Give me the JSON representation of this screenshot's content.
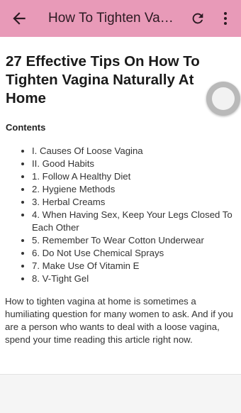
{
  "toolbar": {
    "title": "How To Tighten Vagina Naturally At Home",
    "back_icon": "back-arrow-icon",
    "refresh_icon": "refresh-icon",
    "more_icon": "more-vert-icon",
    "background": "#e89ab8"
  },
  "article": {
    "title": "27 Effective Tips On How To Tighten Vagina Naturally At Home",
    "contents_label": "Contents",
    "toc": [
      "I. Causes Of Loose Vagina",
      "II. Good Habits",
      "1. Follow A Healthy Diet",
      "2. Hygiene Methods",
      "3. Herbal Creams",
      "4. When Having Sex, Keep Your Legs Closed To Each Other",
      "5. Remember To Wear Cotton Underwear",
      "6. Do Not Use Chemical Sprays",
      "7. Make Use Of Vitamin E",
      "8. V-Tight Gel"
    ],
    "intro": "How to tighten vagina at home is sometimes a humiliating question for many women to ask. And if you are a person who wants to deal with a loose vagina, spend your time reading this article right now."
  }
}
